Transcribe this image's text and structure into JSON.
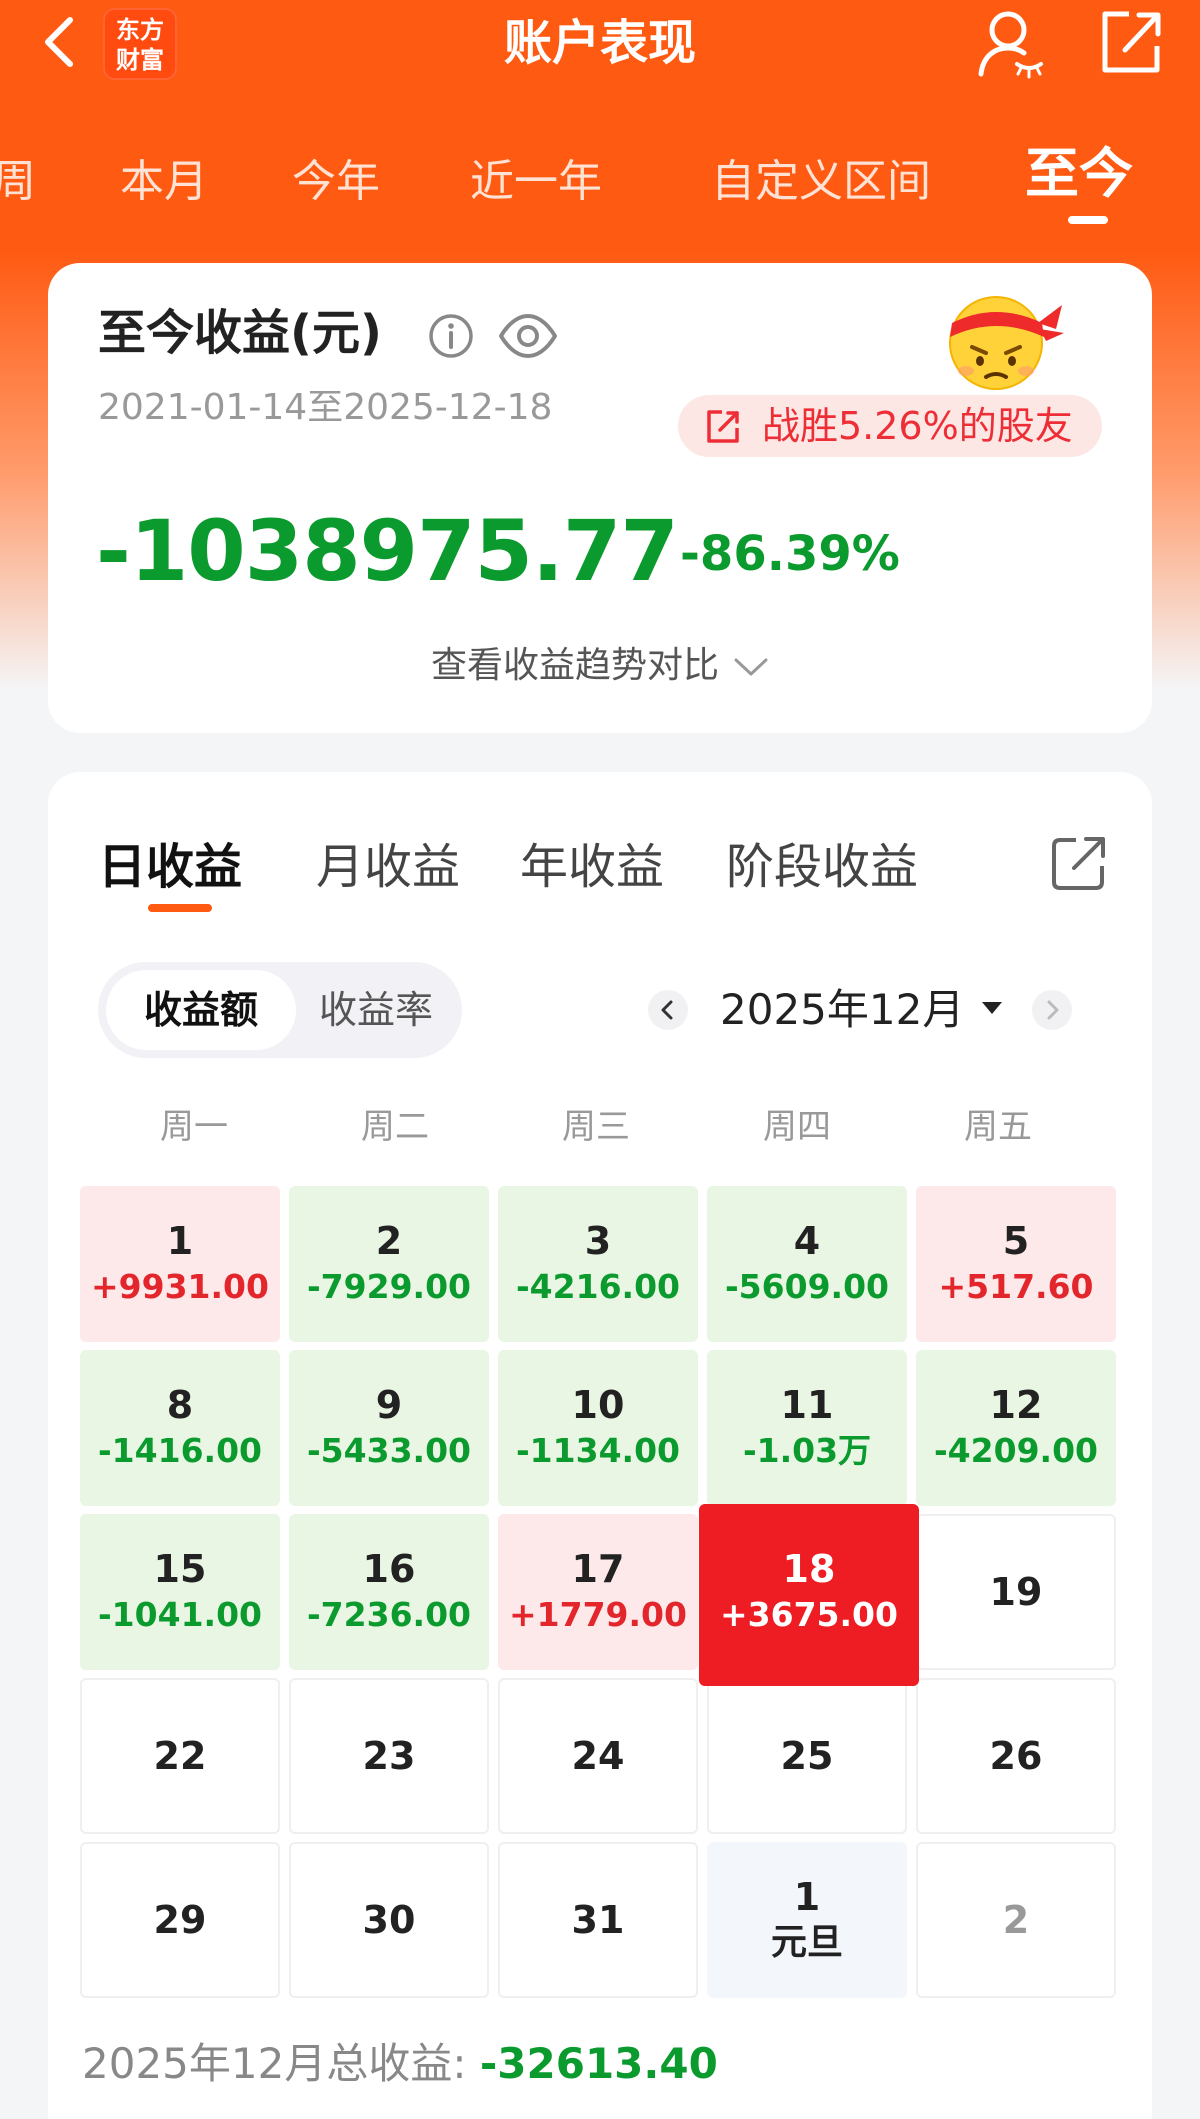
{
  "header": {
    "title": "账户表现",
    "logo_line1": "东方",
    "logo_line2": "财富"
  },
  "period_tabs": [
    "周",
    "本月",
    "今年",
    "近一年",
    "自定义区间",
    "至今"
  ],
  "active_period": "至今",
  "summary": {
    "title": "至今收益(元)",
    "date_range": "2021-01-14至2025-12-18",
    "beat_text": "战胜5.26%的股友",
    "total_value": "-1038975.77",
    "total_pct": "-86.39%",
    "trend_link": "查看收益趋势对比"
  },
  "calendar": {
    "tabs": [
      "日收益",
      "月收益",
      "年收益",
      "阶段收益"
    ],
    "active_tab": "日收益",
    "toggle": [
      "收益额",
      "收益率"
    ],
    "active_toggle": "收益额",
    "month_label": "2025年12月",
    "weekdays": [
      "周一",
      "周二",
      "周三",
      "周四",
      "周五"
    ],
    "weeks": [
      [
        {
          "day": "1",
          "value": "+9931.00",
          "trend": "up"
        },
        {
          "day": "2",
          "value": "-7929.00",
          "trend": "down"
        },
        {
          "day": "3",
          "value": "-4216.00",
          "trend": "down"
        },
        {
          "day": "4",
          "value": "-5609.00",
          "trend": "down"
        },
        {
          "day": "5",
          "value": "+517.60",
          "trend": "up"
        }
      ],
      [
        {
          "day": "8",
          "value": "-1416.00",
          "trend": "down"
        },
        {
          "day": "9",
          "value": "-5433.00",
          "trend": "down"
        },
        {
          "day": "10",
          "value": "-1134.00",
          "trend": "down"
        },
        {
          "day": "11",
          "value": "-1.03万",
          "trend": "down"
        },
        {
          "day": "12",
          "value": "-4209.00",
          "trend": "down"
        }
      ],
      [
        {
          "day": "15",
          "value": "-1041.00",
          "trend": "down"
        },
        {
          "day": "16",
          "value": "-7236.00",
          "trend": "down"
        },
        {
          "day": "17",
          "value": "+1779.00",
          "trend": "up"
        },
        {
          "day": "18",
          "value": "+3675.00",
          "trend": "today"
        },
        {
          "day": "19",
          "value": "",
          "trend": "none"
        }
      ],
      [
        {
          "day": "22",
          "value": "",
          "trend": "none"
        },
        {
          "day": "23",
          "value": "",
          "trend": "none"
        },
        {
          "day": "24",
          "value": "",
          "trend": "none"
        },
        {
          "day": "25",
          "value": "",
          "trend": "none"
        },
        {
          "day": "26",
          "value": "",
          "trend": "none"
        }
      ],
      [
        {
          "day": "29",
          "value": "",
          "trend": "none"
        },
        {
          "day": "30",
          "value": "",
          "trend": "none"
        },
        {
          "day": "31",
          "value": "",
          "trend": "none"
        },
        {
          "day": "1",
          "value": "元旦",
          "trend": "holiday"
        },
        {
          "day": "2",
          "value": "",
          "trend": "next-month"
        }
      ]
    ],
    "total_label": "2025年12月总收益: ",
    "total_value": "-32613.40"
  },
  "colors": {
    "brand": "#ff5a12",
    "gain": "#e3252c",
    "loss": "#0b9a2e",
    "today": "#ee1c23"
  }
}
